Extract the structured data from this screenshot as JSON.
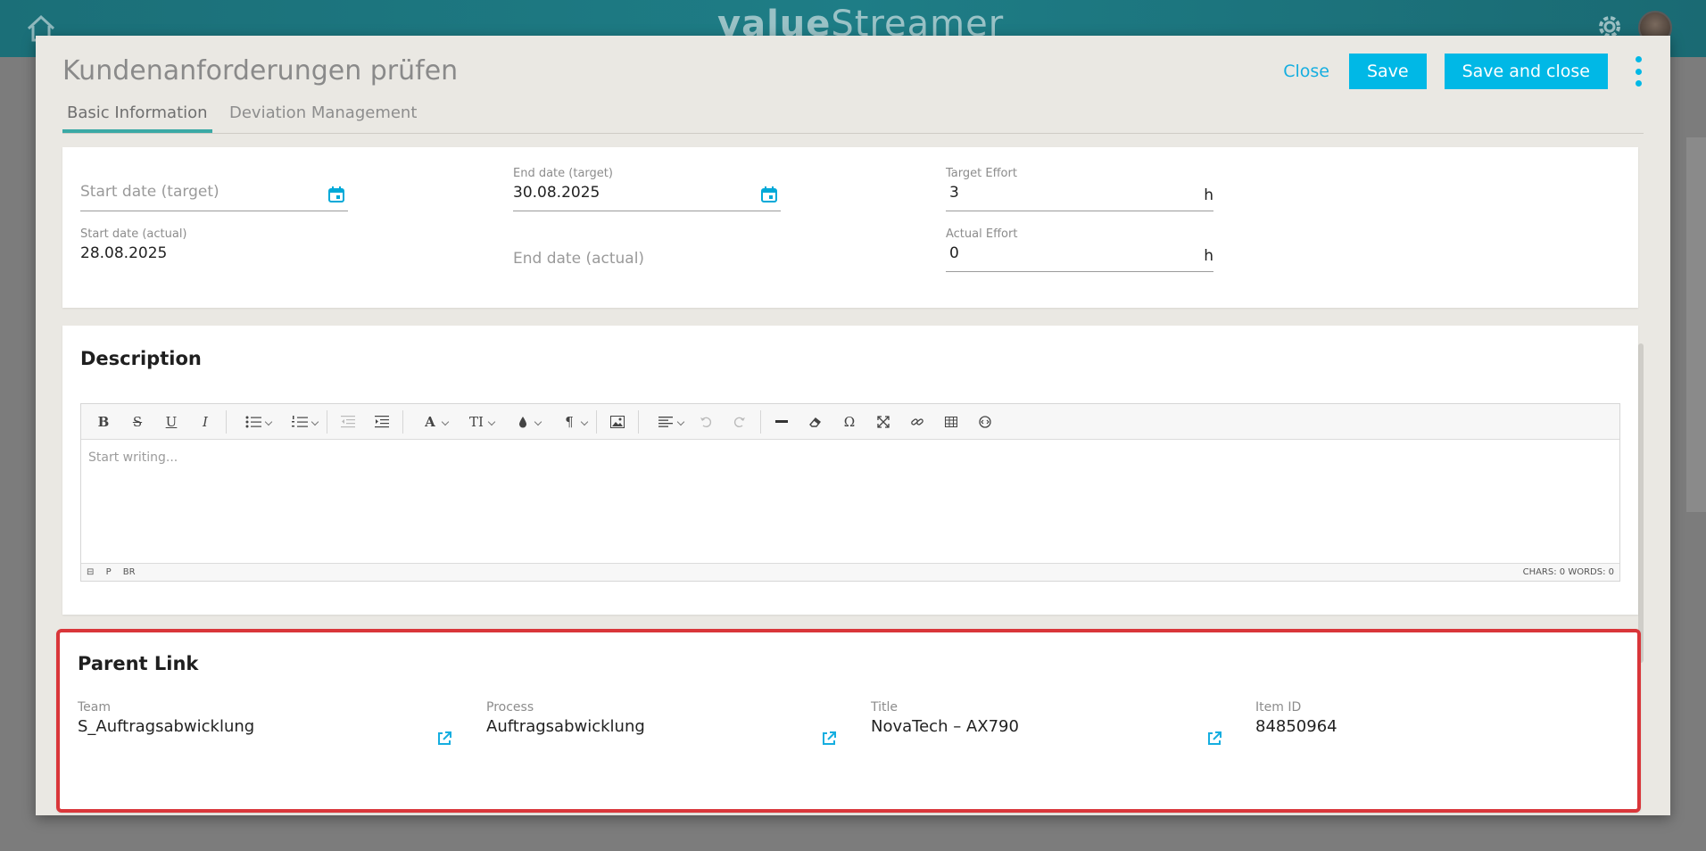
{
  "app": {
    "logo_main": "value",
    "logo_rest": "treamer",
    "brand_color": "#1b6f78",
    "icons": [
      "home-icon",
      "gear-icon"
    ]
  },
  "modal": {
    "title": "Kundenanforderungen prüfen",
    "close_label": "Close",
    "save_label": "Save",
    "save_close_label": "Save and close",
    "accent_color": "#00b8e6"
  },
  "tabs": [
    {
      "label": "Basic Information",
      "active": true
    },
    {
      "label": "Deviation Management",
      "active": false
    }
  ],
  "dates": {
    "start_target": {
      "placeholder": "Start date (target)",
      "value": ""
    },
    "end_target": {
      "label": "End date (target)",
      "value": "30.08.2025"
    },
    "target_effort": {
      "label": "Target Effort",
      "value": "3",
      "unit": "h"
    },
    "start_actual": {
      "label": "Start date (actual)",
      "value": "28.08.2025"
    },
    "end_actual": {
      "placeholder": "End date (actual)",
      "value": ""
    },
    "actual_effort": {
      "label": "Actual Effort",
      "value": "0",
      "unit": "h"
    }
  },
  "description": {
    "title": "Description",
    "placeholder": "Start writing...",
    "status_left": [
      "P",
      "BR"
    ],
    "status_right": "CHARS: 0   WORDS: 0",
    "toolbar": {
      "bold": "B",
      "strike": "S",
      "underline": "U",
      "italic": "I",
      "font_color": "A",
      "text_size": "TI",
      "paragraph": "¶",
      "special_char": "Ω"
    }
  },
  "parent_link": {
    "title": "Parent Link",
    "highlight_color": "#d9363a",
    "team": {
      "label": "Team",
      "value": "S_Auftragsabwicklung"
    },
    "process": {
      "label": "Process",
      "value": "Auftragsabwicklung"
    },
    "title_field": {
      "label": "Title",
      "value": "NovaTech – AX790"
    },
    "item_id": {
      "label": "Item ID",
      "value": "84850964"
    }
  }
}
